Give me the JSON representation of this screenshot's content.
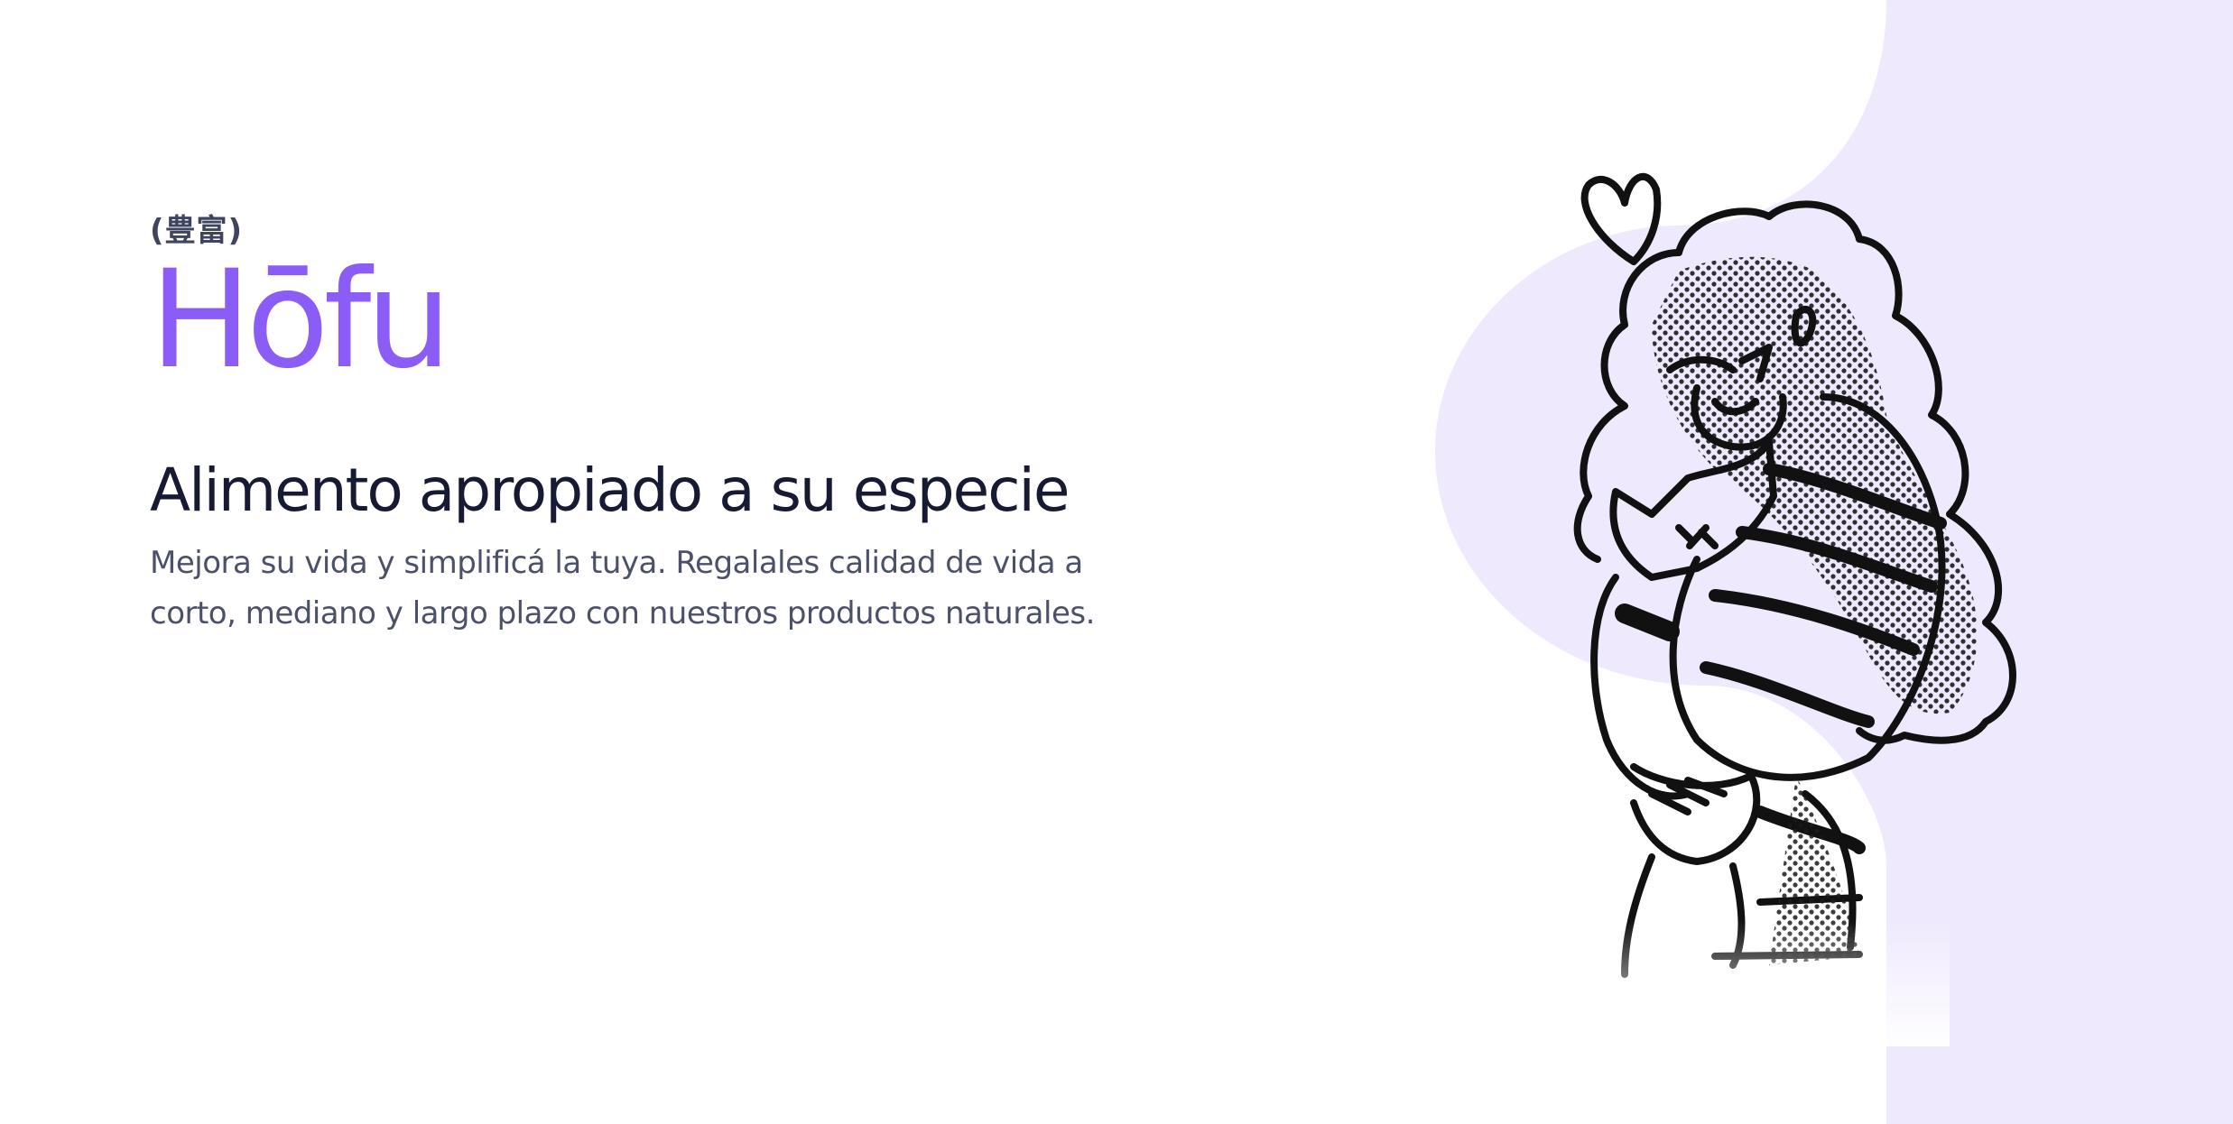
{
  "hero": {
    "kanji": "(豊富)",
    "brand": "Hōfu",
    "headline": "Alimento apropiado a su especie",
    "description": "Mejora su vida y simplificá la tuya. Regalales calidad de vida a corto, mediano y largo plazo con nuestros productos naturales."
  },
  "illustration": {
    "subject": "girl-hugging-cat-illustration",
    "accent_color": "#efe9fd"
  },
  "colors": {
    "brand": "#8b5cf6",
    "headline": "#161a33",
    "body": "#4b5168",
    "panel": "#efe9fd"
  }
}
